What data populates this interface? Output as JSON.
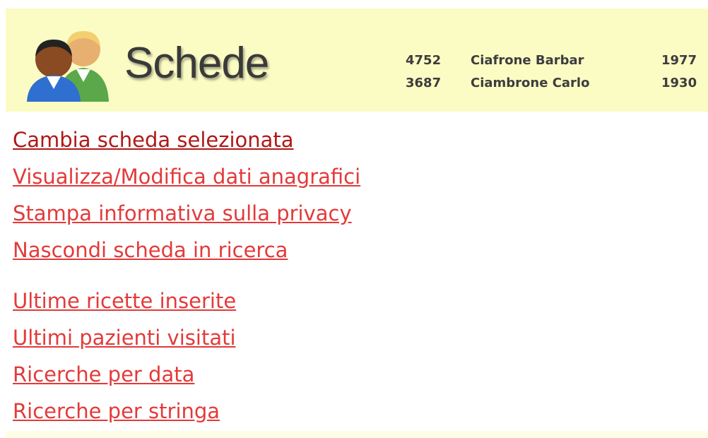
{
  "header": {
    "title": "Schede",
    "logo_icon": "users-icon",
    "background": "#fbfbc4",
    "patients": [
      {
        "id": "4752",
        "name": "Ciafrone Barbar",
        "year": "1977"
      },
      {
        "id": "3687",
        "name": "Ciambrone Carlo",
        "year": "1930"
      }
    ]
  },
  "menu": {
    "group1": [
      {
        "label": "Cambia scheda selezionata"
      },
      {
        "label": "Visualizza/Modifica dati anagrafici"
      },
      {
        "label": "Stampa informativa sulla privacy"
      },
      {
        "label": "Nascondi scheda in ricerca"
      }
    ],
    "group2": [
      {
        "label": "Ultime ricette inserite"
      },
      {
        "label": "Ultimi pazienti visitati"
      },
      {
        "label": "Ricerche per data"
      },
      {
        "label": "Ricerche per stringa"
      }
    ],
    "link_color": "#e33a3a",
    "selected_color": "#b01818"
  }
}
